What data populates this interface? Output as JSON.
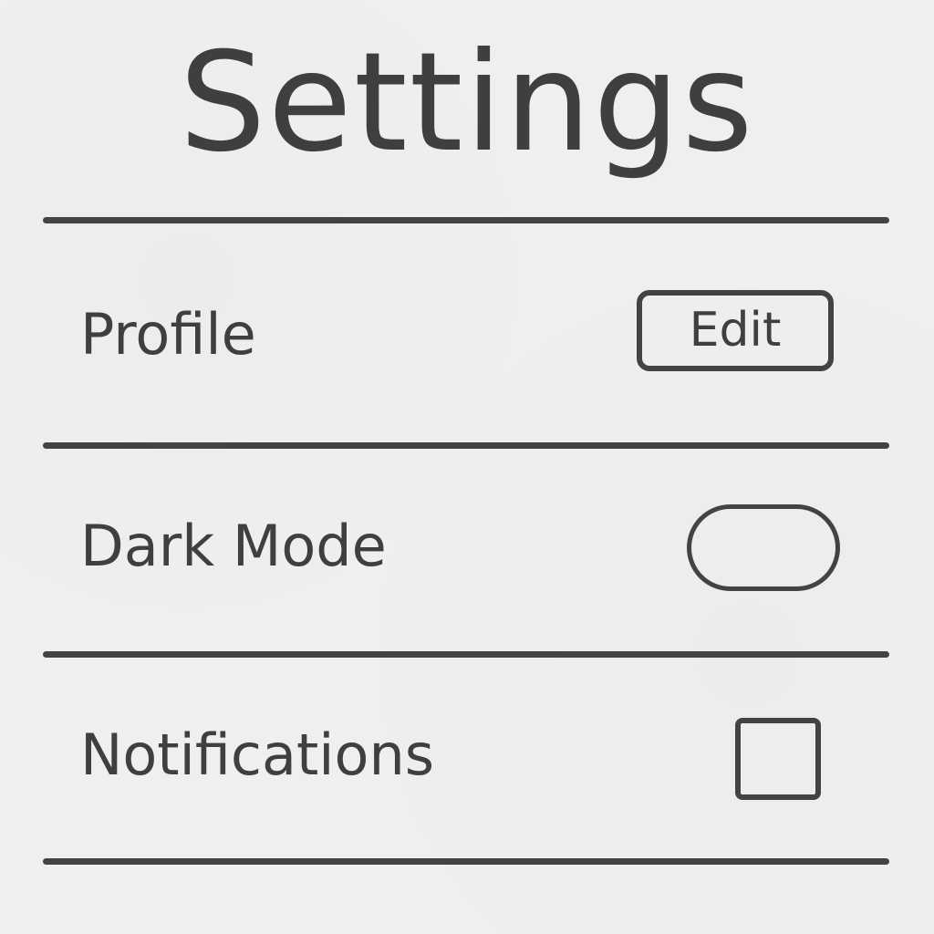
{
  "header": {
    "title": "Settings"
  },
  "rows": {
    "profile": {
      "label": "Profile",
      "action_label": "Edit"
    },
    "dark_mode": {
      "label": "Dark Mode",
      "control": "toggle",
      "enabled": false
    },
    "notifications": {
      "label": "Notifications",
      "control": "checkbox",
      "checked": false
    }
  },
  "colors": {
    "background": "#efefee",
    "foreground": "#3f3f3f",
    "lines": "#434343"
  }
}
